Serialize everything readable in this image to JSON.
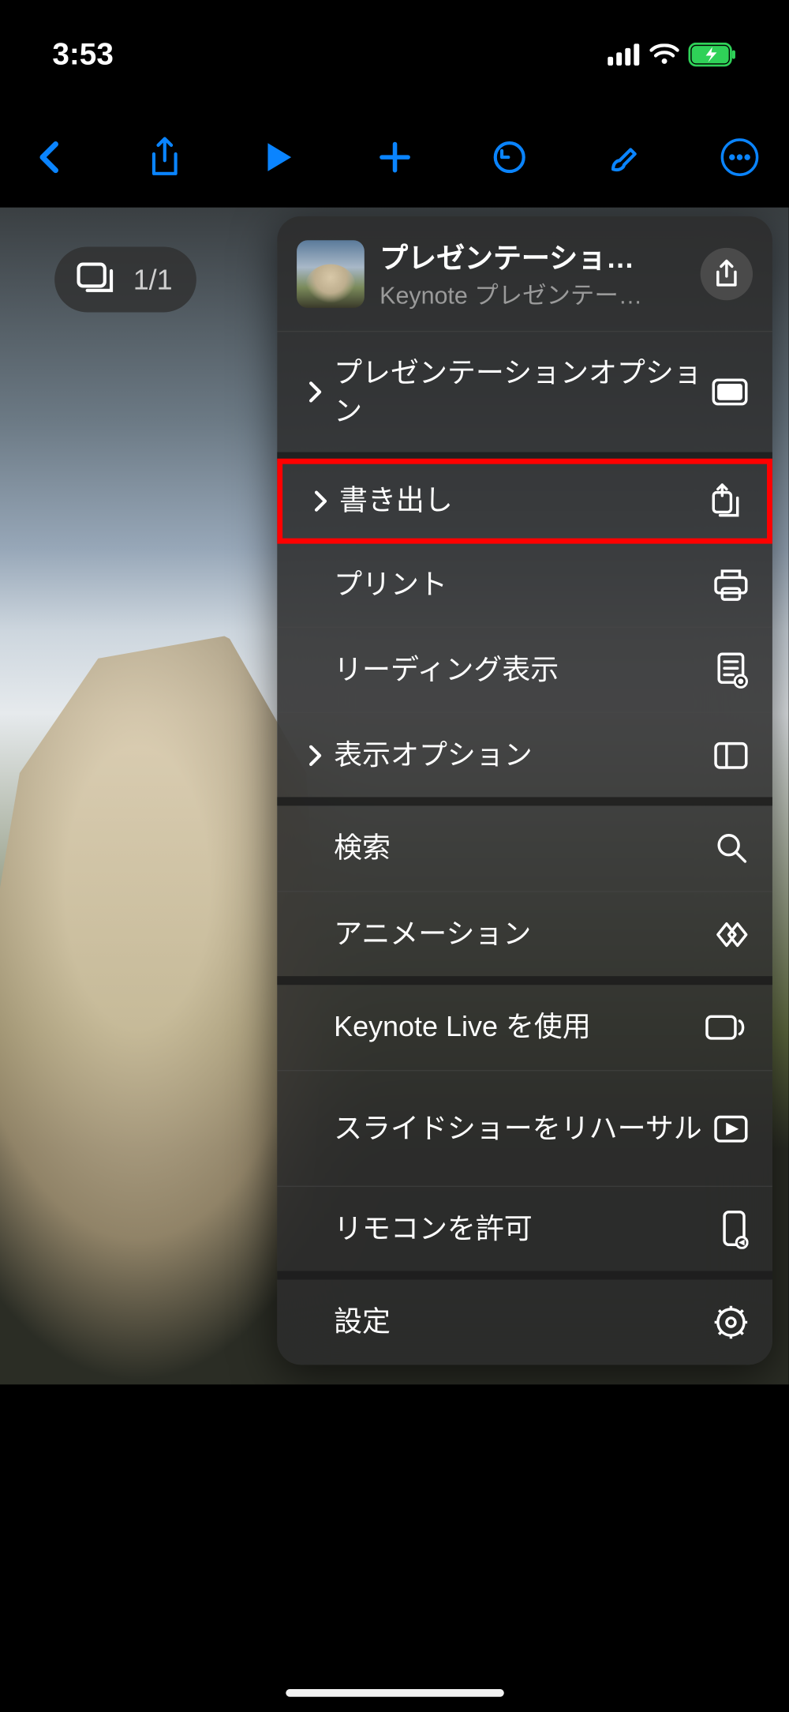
{
  "status": {
    "time": "3:53"
  },
  "slide_counter": {
    "label": "1/1"
  },
  "popover": {
    "header": {
      "title": "プレゼンテーショ…",
      "subtitle": "Keynote プレゼンテー…"
    },
    "groups": [
      {
        "items": [
          {
            "id": "presentation-options",
            "label": "プレゼンテーションオプション",
            "chevron": true,
            "icon": "display",
            "multiline": true
          }
        ]
      },
      {
        "items": [
          {
            "id": "export",
            "label": "書き出し",
            "chevron": true,
            "icon": "export",
            "highlight": true
          },
          {
            "id": "print",
            "label": "プリント",
            "chevron": false,
            "icon": "printer"
          },
          {
            "id": "reader-view",
            "label": "リーディング表示",
            "chevron": false,
            "icon": "reader"
          },
          {
            "id": "view-options",
            "label": "表示オプション",
            "chevron": true,
            "icon": "sidebar"
          }
        ]
      },
      {
        "items": [
          {
            "id": "search",
            "label": "検索",
            "chevron": false,
            "icon": "search"
          },
          {
            "id": "animation",
            "label": "アニメーション",
            "chevron": false,
            "icon": "diamond"
          }
        ]
      },
      {
        "items": [
          {
            "id": "keynote-live",
            "label": "Keynote Live を使用",
            "chevron": false,
            "icon": "broadcast"
          },
          {
            "id": "rehearse",
            "label": "スライドショーをリハーサル",
            "chevron": false,
            "icon": "play-rect",
            "multiline": true
          },
          {
            "id": "remote",
            "label": "リモコンを許可",
            "chevron": false,
            "icon": "remote"
          }
        ]
      },
      {
        "items": [
          {
            "id": "settings",
            "label": "設定",
            "chevron": false,
            "icon": "gear"
          }
        ]
      }
    ]
  }
}
